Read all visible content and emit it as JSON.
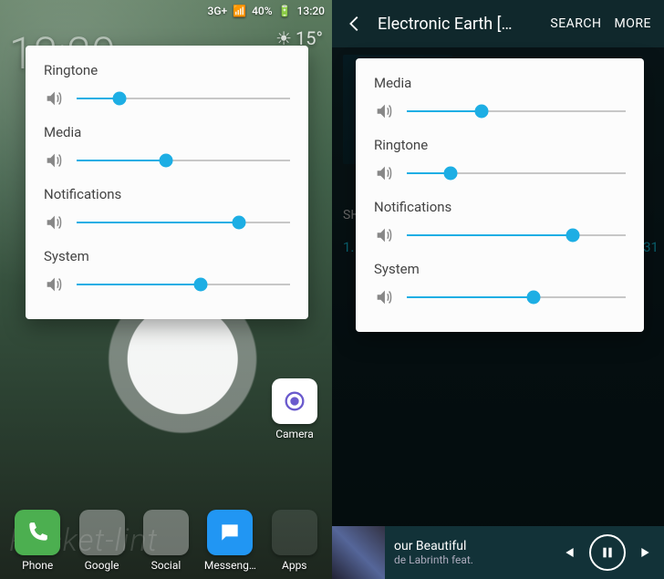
{
  "left": {
    "status": {
      "net": "3G+",
      "signal": "▮▮▮▯",
      "battery_pct": "40%",
      "time": "13:20"
    },
    "home": {
      "clock": "13:20",
      "weather_temp": "15°"
    },
    "camera_label": "Camera",
    "dock": {
      "phone": "Phone",
      "google": "Google",
      "social": "Social",
      "messenger": "Messeng…",
      "apps": "Apps"
    },
    "volume": {
      "rows": [
        {
          "label": "Ringtone",
          "pct": 20
        },
        {
          "label": "Media",
          "pct": 42
        },
        {
          "label": "Notifications",
          "pct": 76
        },
        {
          "label": "System",
          "pct": 58
        }
      ]
    },
    "watermark": "Pocket-lint"
  },
  "right": {
    "appbar": {
      "title": "Electronic Earth […",
      "search": "SEARCH",
      "more": "MORE"
    },
    "bg": {
      "sh": "SH",
      "trackno": "1.",
      "trackright": "31"
    },
    "volume": {
      "rows": [
        {
          "label": "Media",
          "pct": 34
        },
        {
          "label": "Ringtone",
          "pct": 20
        },
        {
          "label": "Notifications",
          "pct": 76
        },
        {
          "label": "System",
          "pct": 58
        }
      ]
    },
    "miniplayer": {
      "title": "our Beautiful",
      "subtitle": "de       Labrinth feat."
    }
  },
  "colors": {
    "accent": "#1daee4"
  }
}
